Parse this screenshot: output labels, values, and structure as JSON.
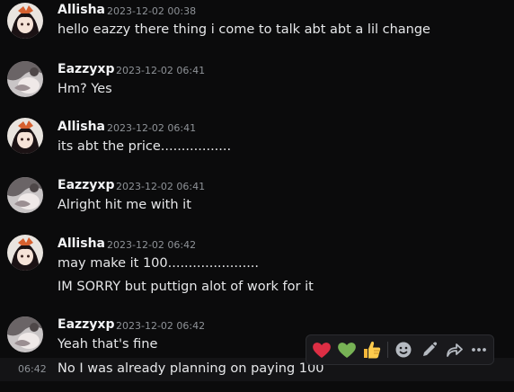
{
  "messages": [
    {
      "author": "Allisha",
      "timestamp": "2023-12-02 00:38",
      "text": "hello eazzy there thing i come to talk abt abt a lil change"
    },
    {
      "author": "Eazzyxp",
      "timestamp": "2023-12-02 06:41",
      "text": "Hm? Yes"
    },
    {
      "author": "Allisha",
      "timestamp": "2023-12-02 06:41",
      "text": "its abt the price................."
    },
    {
      "author": "Eazzyxp",
      "timestamp": "2023-12-02 06:41",
      "text": "Alright hit me with it"
    },
    {
      "author": "Allisha",
      "timestamp": "2023-12-02 06:42",
      "text": "may make it 100......................",
      "text2": "IM SORRY but puttign alot of work for it"
    },
    {
      "author": "Eazzyxp",
      "timestamp": "2023-12-02 06:42",
      "text": "Yeah that's fine"
    }
  ],
  "hovered_message": {
    "time": "06:42",
    "text": "No I was already planning on paying 100"
  },
  "colors": {
    "background": "#0b0b0c",
    "author": "#f2f3f5",
    "timestamp": "#8e9297",
    "text": "#e6e7e9",
    "toolbar": "#19191c"
  },
  "toolbar": {
    "icons": [
      "red-heart-icon",
      "green-heart-icon",
      "thumbs-up-icon",
      "add-reaction-icon",
      "edit-icon",
      "forward-icon",
      "more-icon"
    ]
  }
}
